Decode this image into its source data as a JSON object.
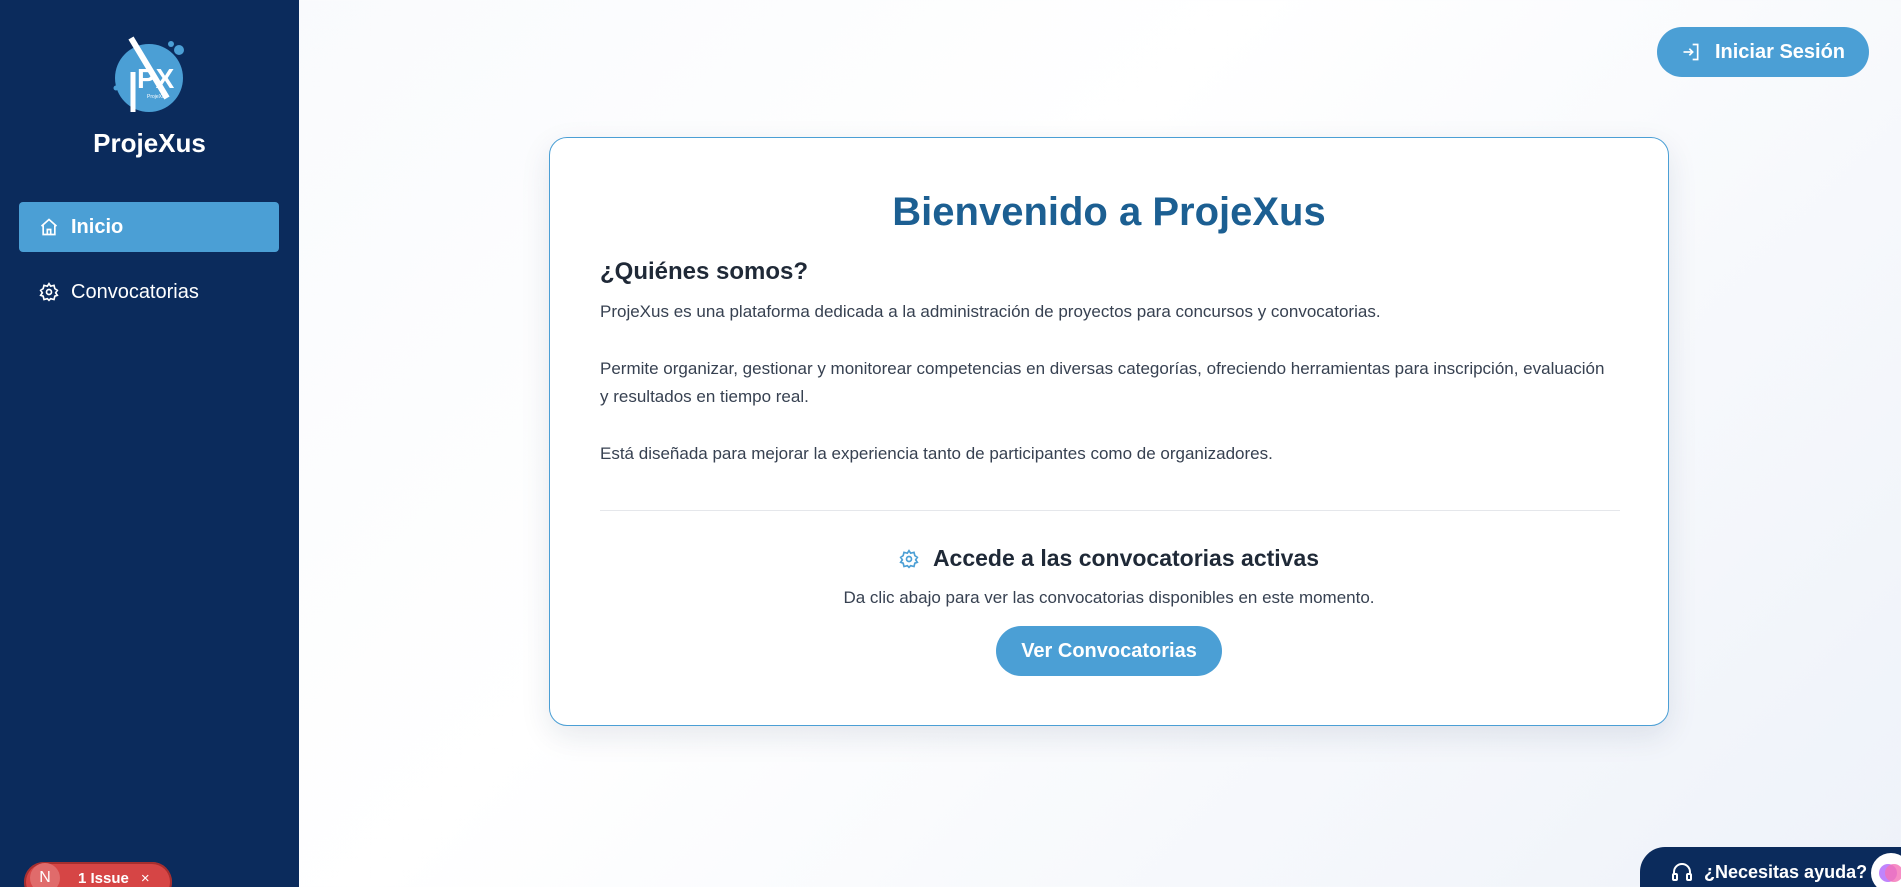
{
  "sidebar": {
    "brand": "ProjeXus",
    "logo_text": "PX",
    "logo_subtext": "ProjeXus",
    "items": [
      {
        "label": "Inicio",
        "icon": "home-icon",
        "active": true
      },
      {
        "label": "Convocatorias",
        "icon": "gear-icon",
        "active": false
      }
    ],
    "issue_badge": {
      "avatar_letter": "N",
      "label": "1 Issue",
      "close": "×"
    }
  },
  "header": {
    "login_label": "Iniciar Sesión",
    "login_icon": "login-icon"
  },
  "main": {
    "title": "Bienvenido a ProjeXus",
    "section_heading": "¿Quiénes somos?",
    "paragraphs": [
      "ProjeXus es una plataforma dedicada a la administración de proyectos para concursos y convocatorias.",
      "Permite organizar, gestionar y monitorear competencias en diversas categorías, ofreciendo herramientas para inscripción, evaluación y resultados en tiempo real.",
      "Está diseñada para mejorar la experiencia tanto de participantes como de organizadores."
    ],
    "cta": {
      "heading": "Accede a las convocatorias activas",
      "subtitle": "Da clic abajo para ver las convocatorias disponibles en este momento.",
      "button_label": "Ver Convocatorias"
    }
  },
  "help": {
    "label": "¿Necesitas ayuda?",
    "icon": "headset-icon"
  },
  "colors": {
    "sidebar_bg": "#0b2b5c",
    "accent": "#4b9fd5",
    "title": "#1c5f92",
    "issue": "#d64545"
  }
}
